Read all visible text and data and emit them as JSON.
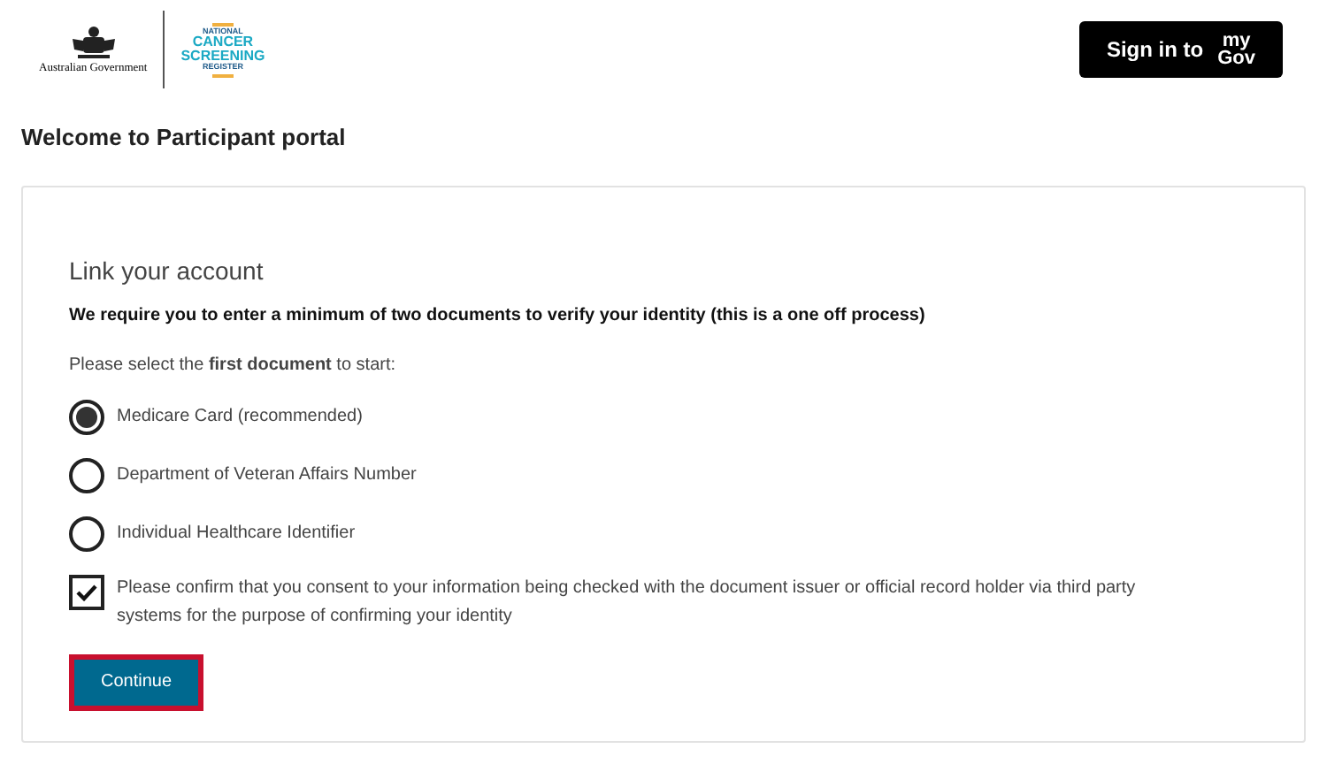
{
  "header": {
    "government_logo": "Australian Government",
    "register_logo": [
      "NATIONAL",
      "CANCER",
      "SCREENING",
      "REGISTER"
    ],
    "sign_in_button": {
      "label": "Sign in to",
      "brand": [
        "my",
        "Gov"
      ]
    }
  },
  "page_title": "Welcome to Participant portal",
  "card": {
    "heading": "Link your account",
    "intro": "We require you to enter a minimum of two documents to verify your identity (this is a one off process)",
    "prompt": "Please select the **first document** to start:",
    "options": [
      {
        "label": "Medicare Card (recommended)",
        "selected": true
      },
      {
        "label": "Department of Veteran Affairs Number",
        "selected": false
      },
      {
        "label": "Individual Healthcare Identifier",
        "selected": false
      }
    ],
    "consent": {
      "label": "Please confirm that you consent to your information being checked with the document issuer or official record holder via third party systems for the purpose of confirming your identity",
      "checked": true
    },
    "continue_button": {
      "label": "Continue",
      "focused": true
    }
  }
}
